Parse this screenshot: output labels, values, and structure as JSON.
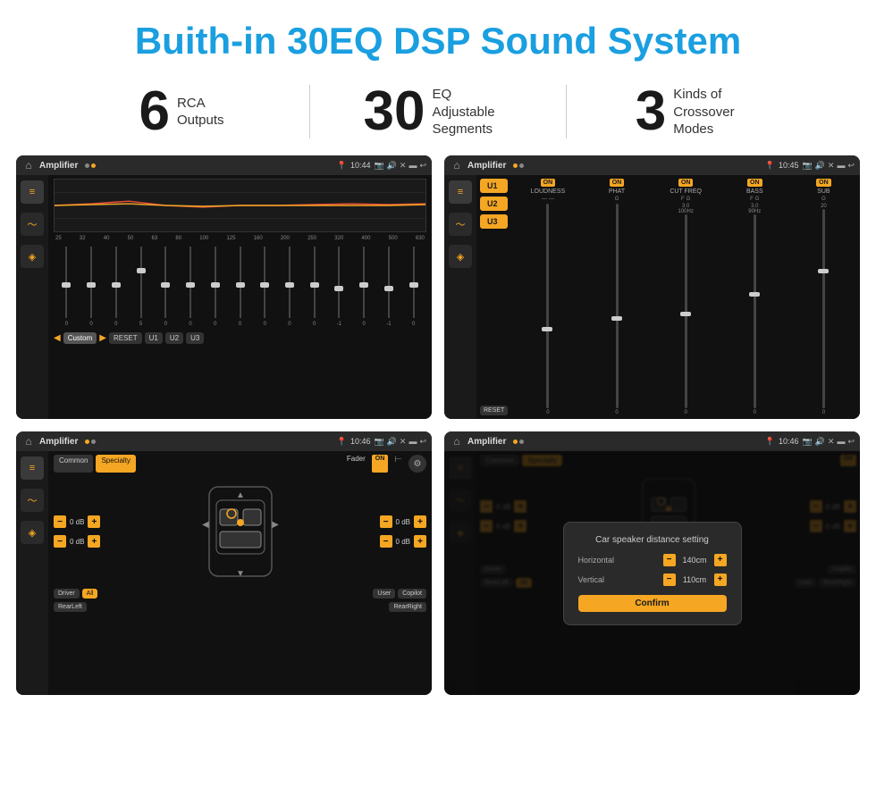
{
  "page": {
    "title": "Buith-in 30EQ DSP Sound System"
  },
  "stats": [
    {
      "number": "6",
      "text": "RCA\nOutputs"
    },
    {
      "number": "30",
      "text": "EQ Adjustable\nSegments"
    },
    {
      "number": "3",
      "text": "Kinds of\nCrossover Modes"
    }
  ],
  "screens": [
    {
      "id": "eq-screen",
      "title": "Amplifier",
      "time": "10:44",
      "eq_labels": [
        "25",
        "32",
        "40",
        "50",
        "63",
        "80",
        "100",
        "125",
        "160",
        "200",
        "250",
        "320",
        "400",
        "500",
        "630"
      ],
      "eq_values": [
        0,
        0,
        0,
        5,
        0,
        0,
        0,
        0,
        0,
        0,
        0,
        -1,
        0,
        -1
      ],
      "bottom_btns": [
        "Custom",
        "RESET",
        "U1",
        "U2",
        "U3"
      ]
    },
    {
      "id": "crossover-screen",
      "title": "Amplifier",
      "time": "10:45",
      "user_btns": [
        "U1",
        "U2",
        "U3"
      ],
      "channels": [
        "LOUDNESS",
        "PHAT",
        "CUT FREQ",
        "BASS",
        "SUB"
      ],
      "reset_label": "RESET"
    },
    {
      "id": "fader-screen",
      "title": "Amplifier",
      "time": "10:46",
      "tabs": [
        "Common",
        "Specialty"
      ],
      "fader_label": "Fader",
      "on_label": "ON",
      "db_values": [
        "0 dB",
        "0 dB",
        "0 dB",
        "0 dB"
      ],
      "bottom_btns": [
        "Driver",
        "All",
        "User",
        "RearLeft",
        "Copilot",
        "RearRight"
      ]
    },
    {
      "id": "dialog-screen",
      "title": "Amplifier",
      "time": "10:46",
      "tabs": [
        "Common",
        "Specialty"
      ],
      "on_label": "ON",
      "dialog": {
        "title": "Car speaker distance setting",
        "horizontal_label": "Horizontal",
        "horizontal_value": "140cm",
        "vertical_label": "Vertical",
        "vertical_value": "110cm",
        "confirm_label": "Confirm"
      },
      "db_values": [
        "0 dB",
        "0 dB"
      ],
      "bottom_btns": [
        "Driver",
        "RearLeft",
        "All",
        "Copilot",
        "User",
        "RearRight"
      ]
    }
  ]
}
